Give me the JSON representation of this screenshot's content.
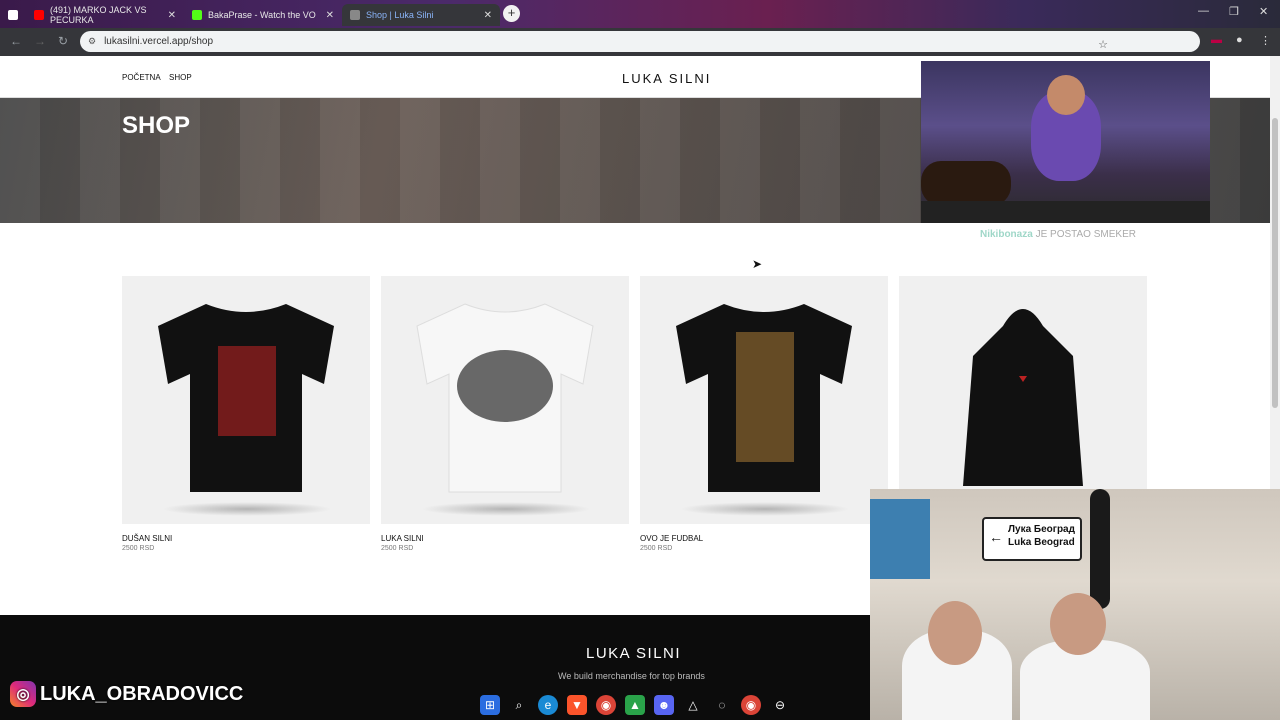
{
  "tabs": [
    {
      "title": "(491) MARKO JACK VS PECURKA",
      "favicon_color": "#ff0000"
    },
    {
      "title": "BakaPrase - Watch the VO",
      "favicon_color": "#53fc18"
    },
    {
      "title": "Shop | Luka Silni",
      "favicon_color": "#888888"
    }
  ],
  "address_bar": {
    "url": "lukasilni.vercel.app/shop"
  },
  "site": {
    "nav": [
      "POČETNA",
      "SHOP"
    ],
    "brand": "LUKA SILNI",
    "hero_title": "SHOP",
    "products": [
      {
        "name": "DUŠAN SILNI",
        "price": "2500 RSD",
        "color": "#111111",
        "type": "tshirt"
      },
      {
        "name": "LUKA SILNI",
        "price": "2500 RSD",
        "color": "#f4f4f4",
        "type": "tshirt"
      },
      {
        "name": "OVO JE FUDBAL",
        "price": "2500 RSD",
        "color": "#111111",
        "type": "tshirt"
      },
      {
        "name": "",
        "price": "",
        "color": "#111111",
        "type": "hoodie"
      }
    ],
    "footer": {
      "brand": "LUKA SILNI",
      "tagline": "We build merchandise for top brands"
    }
  },
  "overlays": {
    "donation_user": "Nikibonaza",
    "donation_text": "JE POSTAO SMEKER",
    "street_sign": [
      "Лука Београд",
      "Luka Beograd"
    ],
    "instagram_handle": "LUKA_OBRADOVICC"
  },
  "taskbar_icons": [
    "windows-icon",
    "search-icon",
    "edge-icon",
    "brave-icon",
    "chrome-icon",
    "app-icon",
    "discord-icon",
    "app-icon",
    "app-icon",
    "chrome-icon",
    "app-icon"
  ]
}
